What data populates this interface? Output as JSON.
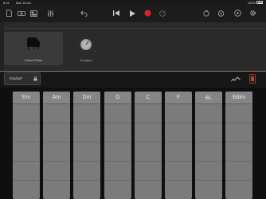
{
  "status": {
    "time": "8:41",
    "date": "Mar 16 tue",
    "battery": "100%"
  },
  "track": {
    "instrument_name": "Grand Piano",
    "knob_label": "Songtipp"
  },
  "controls": {
    "instrument_button": "Guitar"
  },
  "chords": [
    "Em",
    "Am",
    "Dm",
    "G",
    "C",
    "F",
    "B♭",
    "Bdim"
  ],
  "colors": {
    "record": "#e1202d",
    "divider": "#a07a1e",
    "record_toggle": "#d43b1f"
  }
}
